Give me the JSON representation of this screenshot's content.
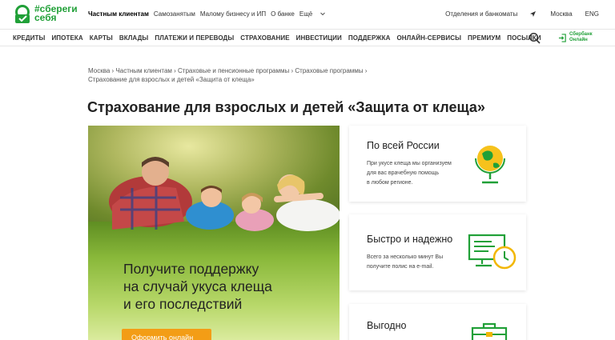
{
  "header": {
    "logo_line1": "#сбереги",
    "logo_line2": "себя",
    "top_links": [
      {
        "label": "Частным клиентам",
        "active": true
      },
      {
        "label": "Самозанятым",
        "active": false
      },
      {
        "label": "Малому бизнесу и ИП",
        "active": false
      },
      {
        "label": "О банке",
        "active": false
      },
      {
        "label": "Ещё",
        "active": false
      }
    ],
    "offices_label": "Отделения и банкоматы",
    "city_label": "Москва",
    "lang_label": "ENG"
  },
  "nav": {
    "items": [
      "КРЕДИТЫ",
      "ИПОТЕКА",
      "КАРТЫ",
      "ВКЛАДЫ",
      "ПЛАТЕЖИ И ПЕРЕВОДЫ",
      "СТРАХОВАНИЕ",
      "ИНВЕСТИЦИИ",
      "ПОДДЕРЖКА",
      "ОНЛАЙН-СЕРВИСЫ",
      "ПРЕМИУМ",
      "ПОСЫЛКИ"
    ],
    "online_line1": "Сбербанк",
    "online_line2": "Онлайн"
  },
  "breadcrumb": [
    "Москва",
    "Частным клиентам",
    "Страховые и пенсионные программы",
    "Страховые программы",
    "Страхование для взрослых и детей «Защита от клеща»"
  ],
  "page_title": "Страхование для взрослых и детей «Защита от клеща»",
  "hero": {
    "lines": [
      "Получите поддержку",
      "на случай укуса клеща",
      "и его последствий"
    ],
    "button_label": "Оформить онлайн"
  },
  "cards": [
    {
      "title": "По всей России",
      "desc": [
        "При укусе клеща мы организуем",
        "для вас врачебную помощь",
        "в любом регионе."
      ],
      "icon": "globe-icon"
    },
    {
      "title": "Быстро и надежно",
      "desc": [
        "Всего за несколько минут Вы",
        "получите полис на e-mail."
      ],
      "icon": "computer-clock-icon"
    },
    {
      "title": "Выгодно",
      "desc": [],
      "icon": "briefcase-icon"
    }
  ],
  "colors": {
    "brand_green": "#21a038",
    "accent_orange": "#f39d16",
    "icon_yellow": "#f2b705"
  }
}
